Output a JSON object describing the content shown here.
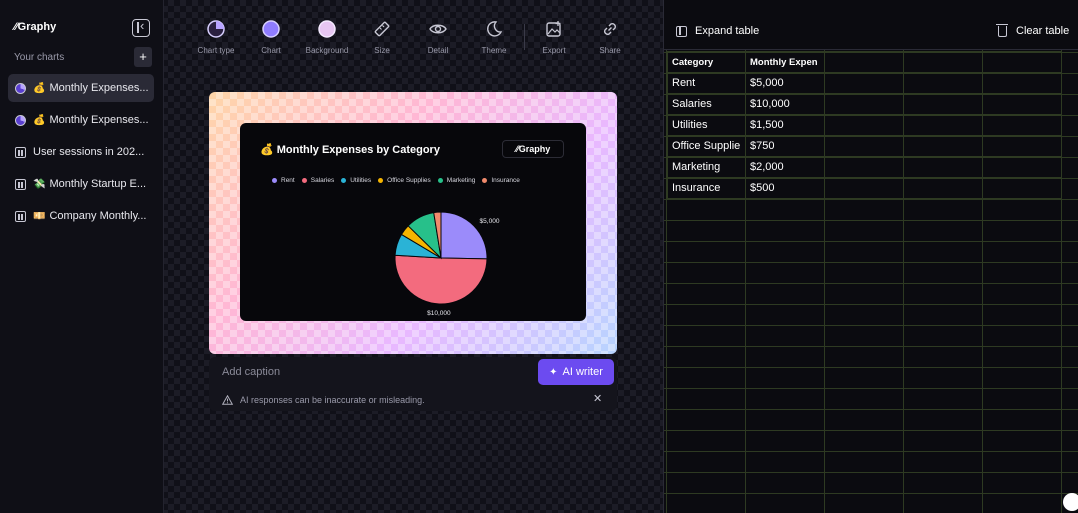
{
  "sidebar": {
    "logo": "⁄⁄Graphy",
    "section_label": "Your charts",
    "new_chart_label": "+",
    "items": [
      {
        "emoji": "💰",
        "label": "Monthly Expenses...",
        "icon": "pie-chart-icon",
        "active": true
      },
      {
        "emoji": "💰",
        "label": "Monthly Expenses...",
        "icon": "pie-chart-icon",
        "active": false
      },
      {
        "emoji": "",
        "label": "User sessions in 202...",
        "icon": "bar-chart-icon",
        "active": false
      },
      {
        "emoji": "💸",
        "label": "Monthly Startup E...",
        "icon": "bar-chart-icon",
        "active": false
      },
      {
        "emoji": "💴",
        "label": "Company Monthly...",
        "icon": "bar-chart-icon",
        "active": false
      }
    ]
  },
  "toolbar": {
    "chart_type": "Chart type",
    "chart": "Chart",
    "background": "Background",
    "size": "Size",
    "detail": "Detail",
    "theme": "Theme",
    "export": "Export",
    "share": "Share"
  },
  "card": {
    "title": "💰 Monthly Expenses by Category",
    "brand": "⁄⁄Graphy"
  },
  "caption": {
    "placeholder": "Add caption",
    "ai_writer": "AI writer",
    "warning": "AI responses can be inaccurate or misleading.",
    "close": "✕"
  },
  "table": {
    "expand_label": "Expand table",
    "clear_label": "Clear table",
    "headers": [
      "Category",
      "Monthly Expen"
    ],
    "rows": [
      [
        "Rent",
        "$5,000"
      ],
      [
        "Salaries",
        "$10,000"
      ],
      [
        "Utilities",
        "$1,500"
      ],
      [
        "Office Supplie",
        "$750"
      ],
      [
        "Marketing",
        "$2,000"
      ],
      [
        "Insurance",
        "$500"
      ]
    ]
  },
  "chart_data": {
    "type": "pie",
    "title": "💰 Monthly Expenses by Category",
    "categories": [
      "Rent",
      "Salaries",
      "Utilities",
      "Office Supplies",
      "Marketing",
      "Insurance"
    ],
    "values": [
      5000,
      10000,
      1500,
      750,
      2000,
      500
    ],
    "colors": [
      "#9b8bfa",
      "#f36b7e",
      "#2ab3d6",
      "#f5b400",
      "#27c08a",
      "#f08a6c"
    ],
    "data_labels": {
      "Rent": "$5,000",
      "Salaries": "$10,000"
    },
    "legend_position": "top"
  },
  "colors": {
    "accent": "#6c4bf0",
    "chart_type_icon": "#b7a3ff",
    "chart_icon": "#8f7cff",
    "background_icon": "#e7c6f2"
  }
}
